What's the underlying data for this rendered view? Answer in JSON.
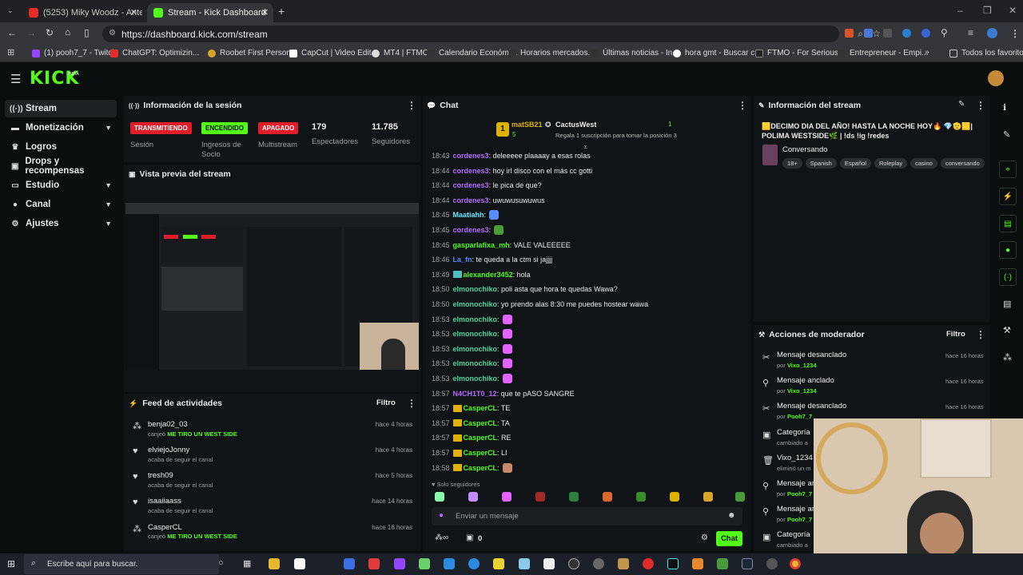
{
  "browser": {
    "tabs": [
      {
        "title": "(5253) Miky Woodz - Antes de"
      },
      {
        "title": "Stream - Kick Dashboard"
      }
    ],
    "url": "https://dashboard.kick.com/stream",
    "bookmarks": [
      "(1) pooh7_7 - Twitch",
      "ChatGPT: Optimizin...",
      "Roobet First Person...",
      "CapCut | Video Edit...",
      "MT4 | FTMO",
      "Calendario Económi...",
      "Horarios mercados...",
      "Últimas noticias - In...",
      "hora gmt - Buscar c...",
      "FTMO - For Serious...",
      "Entrepreneur - Empi...",
      "Todos los favoritos"
    ]
  },
  "header": {
    "logo": "KICK",
    "beta": "BETA"
  },
  "sidebar": {
    "items": [
      {
        "label": "Stream",
        "icon": "broadcast-icon"
      },
      {
        "label": "Monetización",
        "icon": "dollar-icon"
      },
      {
        "label": "Logros",
        "icon": "trophy-icon"
      },
      {
        "label": "Drops y recompensas",
        "icon": "gift-icon"
      },
      {
        "label": "Estudio",
        "icon": "studio-icon"
      },
      {
        "label": "Canal",
        "icon": "user-icon"
      },
      {
        "label": "Ajustes",
        "icon": "gear-icon"
      }
    ]
  },
  "session": {
    "title": "Información de la sesión",
    "live_badge": "TRANSMITIENDO",
    "live_label": "Sesión",
    "on_badge": "ENCENDIDO",
    "on_label": "Ingresos de Socio",
    "off_badge": "APAGADO",
    "off_label": "Multistream",
    "viewers": "179",
    "viewers_label": "Espectadores",
    "followers": "11.785",
    "followers_label": "Seguidores"
  },
  "preview": {
    "title": "Vista previa del stream"
  },
  "activity": {
    "title": "Feed de actividades",
    "filter": "Filtro",
    "items": [
      {
        "name": "benja02_03",
        "sub": "canjeó",
        "reward": "ME TIRO UN WEST SIDE",
        "time": "hace 4 horas"
      },
      {
        "name": "elviejoJonny",
        "sub": "acaba de seguir el canal",
        "reward": "",
        "time": "hace 4 horas"
      },
      {
        "name": "tresh09",
        "sub": "acaba de seguir el canal",
        "reward": "",
        "time": "hace 5 horas"
      },
      {
        "name": "isaaiiaass",
        "sub": "acaba de seguir el canal",
        "reward": "",
        "time": "hace 14 horas"
      },
      {
        "name": "CasperCL",
        "sub": "canjeó",
        "reward": "ME TIRO UN WEST SIDE",
        "time": "hace 16 horas"
      }
    ]
  },
  "chat": {
    "title": "Chat",
    "top_user": "matSB21",
    "top_rank": "1",
    "top_count": "5",
    "top_channel": "CactusWest",
    "top_channel_count": "1",
    "top_sub": "Regala 1 suscripción para tomar la posición 3",
    "messages": [
      {
        "time": "18:43",
        "user": "cordenes3",
        "text": ": deleeeee plaaaay a esas rolas",
        "color": "#b56cff"
      },
      {
        "time": "18:44",
        "user": "cordenes3",
        "text": ": hoy irl disco con el más cc gotti",
        "color": "#b56cff"
      },
      {
        "time": "18:44",
        "user": "cordenes3",
        "text": ": le pica de que?",
        "color": "#b56cff"
      },
      {
        "time": "18:44",
        "user": "cordenes3",
        "text": ": uwuwusuwuwus",
        "color": "#b56cff"
      },
      {
        "time": "18:45",
        "user": "Maatiahh",
        "text": ":",
        "color": "#6be6ff"
      },
      {
        "time": "18:45",
        "user": "cordenes3",
        "text": ":",
        "color": "#b56cff"
      },
      {
        "time": "18:45",
        "user": "gasparlafixa_mh",
        "text": ": VALE VALEEEEE",
        "color": "#53fc18"
      },
      {
        "time": "18:46",
        "user": "La_fn",
        "text": ": te queda a la ctm si jajjjj",
        "color": "#5b8cff"
      },
      {
        "time": "18:49",
        "user": "alexander3452",
        "text": ": hola",
        "color": "#53fc18"
      },
      {
        "time": "18:50",
        "user": "elmonochiko",
        "text": ": poli asta que hora te quedas Wawa?",
        "color": "#53d1a0"
      },
      {
        "time": "18:50",
        "user": "elmonochiko",
        "text": ": yo prendo alas 8:30 me puedes hostear wawa",
        "color": "#53d1a0"
      },
      {
        "time": "18:53",
        "user": "elmonochiko",
        "text": ":",
        "color": "#53d1a0"
      },
      {
        "time": "18:53",
        "user": "elmonochiko",
        "text": ":",
        "color": "#53d1a0"
      },
      {
        "time": "18:53",
        "user": "elmonochiko",
        "text": ":",
        "color": "#53d1a0"
      },
      {
        "time": "18:53",
        "user": "elmonochiko",
        "text": ":",
        "color": "#53d1a0"
      },
      {
        "time": "18:53",
        "user": "elmonochiko",
        "text": ":",
        "color": "#53d1a0"
      },
      {
        "time": "18:57",
        "user": "N4CH1T0_12",
        "text": ": que te pASO SANGRE",
        "color": "#b56cff"
      },
      {
        "time": "18:57",
        "user": "CasperCL",
        "text": ": TE",
        "color": "#53fc18"
      },
      {
        "time": "18:57",
        "user": "CasperCL",
        "text": ": TA",
        "color": "#53fc18"
      },
      {
        "time": "18:57",
        "user": "CasperCL",
        "text": ": RE",
        "color": "#53fc18"
      },
      {
        "time": "18:57",
        "user": "CasperCL",
        "text": ": LI",
        "color": "#53fc18"
      },
      {
        "time": "18:58",
        "user": "CasperCL",
        "text": ":",
        "color": "#53fc18"
      }
    ],
    "followers_only": "Solo seguidores",
    "input_placeholder": "Enviar un mensaje",
    "points": "0",
    "send": "Chat"
  },
  "stream_info": {
    "title": "Información del stream",
    "stream_title": "🟨DECIMO DIA DEL AÑO! HASTA LA NOCHE HOY🔥 💎🫡🟨| POLIMA WESTSIDE🌿 | !ds !ig !redes",
    "category": "Conversando",
    "tags": [
      "18+",
      "Spanish",
      "Español",
      "Roleplay",
      "casino",
      "conversando"
    ]
  },
  "mod": {
    "title": "Acciones de moderador",
    "filter": "Filtro",
    "items": [
      {
        "action": "Mensaje desanclado",
        "by": "por",
        "user": "Vixo_1234",
        "time": "hace 16 horas"
      },
      {
        "action": "Mensaje anclado",
        "by": "por",
        "user": "Vixo_1234",
        "time": "hace 16 horas"
      },
      {
        "action": "Mensaje desanclado",
        "by": "por",
        "user": "Pooh7_7",
        "time": "hace 16 horas"
      },
      {
        "action": "Categoría",
        "by": "cambiado a",
        "user": "",
        "time": ""
      },
      {
        "action": "Vixo_1234",
        "by": "eliminó un m",
        "user": "",
        "time": ""
      },
      {
        "action": "Mensaje an",
        "by": "por",
        "user": "Pooh7_7",
        "time": ""
      },
      {
        "action": "Mensaje an",
        "by": "por",
        "user": "Pooh7_7",
        "time": ""
      },
      {
        "action": "Categoría",
        "by": "cambiado a",
        "user": "",
        "time": ""
      }
    ]
  },
  "taskbar": {
    "search_placeholder": "Escribe aquí para buscar."
  }
}
